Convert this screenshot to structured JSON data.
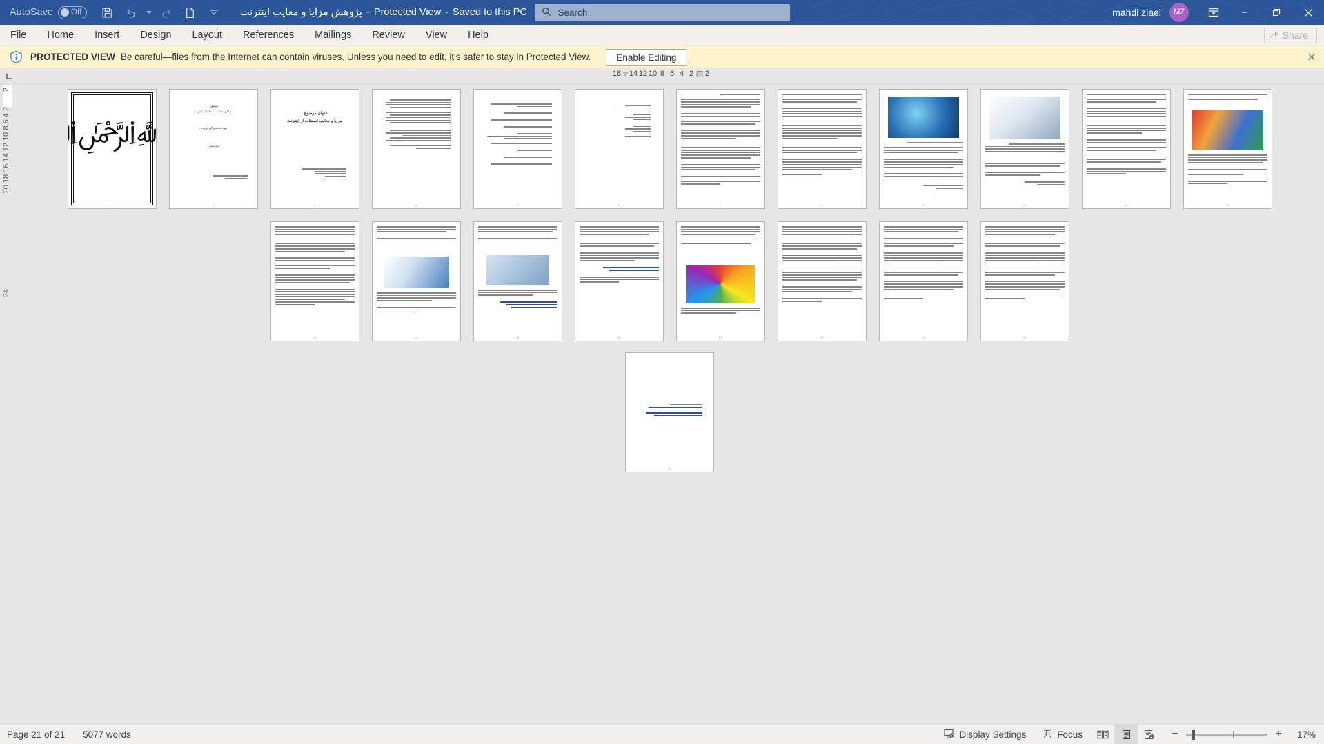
{
  "titlebar": {
    "autosave_label": "AutoSave",
    "autosave_state": "Off",
    "quick_access": [
      "save-icon",
      "undo-icon",
      "undo-dropdown-icon",
      "redo-icon",
      "new-doc-icon",
      "customize-qat-icon"
    ],
    "doc_title_rtl": "پژوهش مزایا و معایب اینترنت",
    "separator1": "-",
    "protected_view_label": "Protected View",
    "separator2": "-",
    "saved_location": "Saved to this PC",
    "title_dropdown_icon": "chevron-down-icon",
    "search_placeholder": "Search",
    "search_icon": "search-icon",
    "user_name": "mahdi ziaei",
    "avatar_initials": "MZ",
    "avatar_color": "#a662c8",
    "ribbon_display_icon": "ribbon-display-options-icon",
    "minimize_icon": "minimize-icon",
    "restore_icon": "restore-icon",
    "close_icon": "close-icon",
    "bg_color": "#2b579a"
  },
  "ribbon": {
    "tabs": [
      {
        "label": "File"
      },
      {
        "label": "Home"
      },
      {
        "label": "Insert"
      },
      {
        "label": "Design"
      },
      {
        "label": "Layout"
      },
      {
        "label": "References"
      },
      {
        "label": "Mailings"
      },
      {
        "label": "Review"
      },
      {
        "label": "View"
      },
      {
        "label": "Help"
      }
    ],
    "share_label": "Share",
    "share_icon": "share-icon"
  },
  "protected_view": {
    "icon": "info-shield-icon",
    "title": "PROTECTED VIEW",
    "message": "Be careful—files from the Internet can contain viruses. Unless you need to edit, it's safer to stay in Protected View.",
    "enable_button": "Enable Editing",
    "close_icon": "close-icon",
    "bg_color": "#fcf4cd"
  },
  "ruler": {
    "tabstop_icon": "left-tab-stop-icon",
    "horizontal_ticks": [
      "18",
      "14",
      "12",
      "10",
      "8",
      "6",
      "4",
      "2",
      "2"
    ],
    "vertical_ticks": [
      "2",
      "6",
      "4",
      "2",
      "2",
      "4",
      "6",
      "8",
      "10",
      "12",
      "14",
      "16",
      "18",
      "20",
      "24"
    ],
    "vertical_label": "20 18 16 14 12 10 8  6  4  2"
  },
  "document": {
    "zoom_thumbnail_view": true,
    "page_count": 21,
    "pages": [
      {
        "n": 1,
        "kind": "bismillah",
        "bismillah": "﷽"
      },
      {
        "n": 2,
        "kind": "title",
        "lines": [
          "موضوع :",
          "مزایا و معایب استفاده از اینترنت",
          "تهیه کننده و گردآورنده :",
          "نام خانوادگی نسب :",
          "نام معلم :"
        ]
      },
      {
        "n": 3,
        "kind": "cover2",
        "lines": [
          "عنوان موضوع :",
          "مزایا و معایب استفاده از اینترنت"
        ]
      },
      {
        "n": 4,
        "kind": "toc"
      },
      {
        "n": 5,
        "kind": "questions"
      },
      {
        "n": 6,
        "kind": "shortlist"
      },
      {
        "n": 7,
        "kind": "text"
      },
      {
        "n": 8,
        "kind": "text"
      },
      {
        "n": 9,
        "kind": "image-text",
        "image": "imgA"
      },
      {
        "n": 10,
        "kind": "image-text",
        "image": "imgB"
      },
      {
        "n": 11,
        "kind": "text"
      },
      {
        "n": 12,
        "kind": "image-text",
        "image": "imgC"
      },
      {
        "n": 13,
        "kind": "text"
      },
      {
        "n": 14,
        "kind": "image-text",
        "image": "imgD"
      },
      {
        "n": 15,
        "kind": "image-text",
        "image": "imgE"
      },
      {
        "n": 16,
        "kind": "text"
      },
      {
        "n": 17,
        "kind": "image-text",
        "image": "imgF"
      },
      {
        "n": 18,
        "kind": "text"
      },
      {
        "n": 19,
        "kind": "text"
      },
      {
        "n": 20,
        "kind": "text"
      },
      {
        "n": 21,
        "kind": "links"
      }
    ]
  },
  "statusbar": {
    "page_status": "Page 21 of 21",
    "word_count": "5077 words",
    "display_settings_label": "Display Settings",
    "display_settings_icon": "display-settings-icon",
    "focus_label": "Focus",
    "focus_icon": "focus-icon",
    "read_mode_icon": "read-mode-icon",
    "print_layout_icon": "print-layout-icon",
    "web_layout_icon": "web-layout-icon",
    "zoom_out_icon": "minus-icon",
    "zoom_in_icon": "plus-icon",
    "zoom_level": "17%"
  }
}
